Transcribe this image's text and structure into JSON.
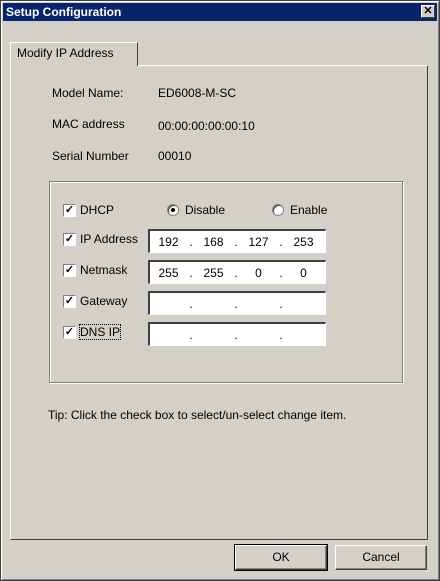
{
  "window": {
    "title": "Setup Configuration",
    "close_glyph": "✕"
  },
  "tab": {
    "label": "Modify IP Address"
  },
  "info": {
    "model_name_label": "Model Name:",
    "model_name_value": "ED6008-M-SC",
    "mac_label": "MAC address",
    "mac_value": "00:00:00:00:00:10",
    "serial_label": "Serial Number",
    "serial_value": "00010"
  },
  "dhcp": {
    "label": "DHCP",
    "checked": true,
    "disable_label": "Disable",
    "enable_label": "Enable",
    "selected": "Disable"
  },
  "ip_address": {
    "label": "IP Address",
    "checked": true,
    "octets": [
      "192",
      "168",
      "127",
      "253"
    ]
  },
  "netmask": {
    "label": "Netmask",
    "checked": true,
    "octets": [
      "255",
      "255",
      "0",
      "0"
    ]
  },
  "gateway": {
    "label": "Gateway",
    "checked": true,
    "octets": [
      "",
      "",
      "",
      ""
    ]
  },
  "dns_ip": {
    "label": "DNS IP",
    "checked": true,
    "octets": [
      "",
      "",
      "",
      ""
    ]
  },
  "tip": "Tip: Click the check box to select/un-select change item.",
  "buttons": {
    "ok": "OK",
    "cancel": "Cancel"
  },
  "colors": {
    "titlebar": "#0a246a",
    "face": "#d4d0c8"
  }
}
